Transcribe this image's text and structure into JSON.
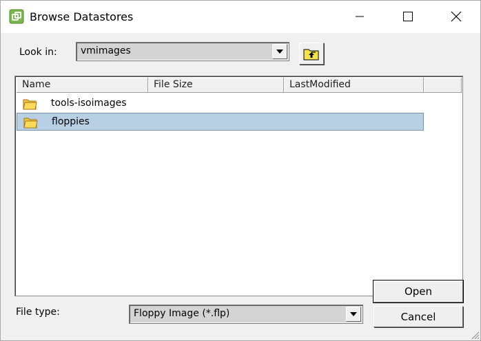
{
  "window": {
    "title": "Browse Datastores",
    "controls": {
      "minimize_icon": "minimize-icon",
      "maximize_icon": "maximize-icon",
      "close_icon": "close-icon"
    }
  },
  "look_in": {
    "label": "Look in:",
    "value": "vmimages",
    "up_button_icon": "up-folder-icon"
  },
  "file_list": {
    "columns": [
      "Name",
      "File Size",
      "LastModified"
    ],
    "items": [
      {
        "name": "tools-isoimages",
        "icon": "folder-icon",
        "selected": false
      },
      {
        "name": "floppies",
        "icon": "folder-icon",
        "selected": true
      }
    ]
  },
  "file_type": {
    "label": "File type:",
    "value": "Floppy Image (*.flp)"
  },
  "buttons": {
    "open": "Open",
    "cancel": "Cancel"
  },
  "colors": {
    "selection": "#b8cfe4",
    "folder": "#f5c542",
    "app_icon": "#79b84a"
  }
}
